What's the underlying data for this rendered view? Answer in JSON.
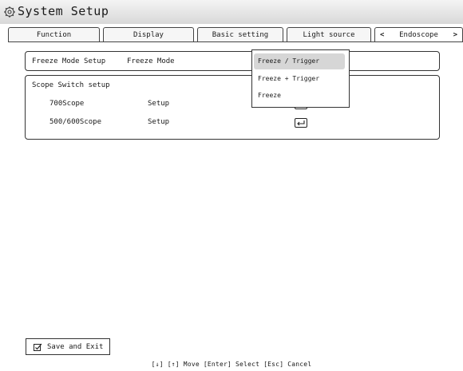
{
  "window": {
    "title": "System Setup",
    "title_icon": "gear-icon"
  },
  "tabs": [
    {
      "label": "Function"
    },
    {
      "label": "Display"
    },
    {
      "label": "Basic setting"
    },
    {
      "label": "Light source"
    },
    {
      "label": "Endoscope",
      "active": true
    }
  ],
  "tab_nav": {
    "prev": "<",
    "next": ">"
  },
  "freeze": {
    "section_label": "Freeze Mode Setup",
    "field_label": "Freeze Mode",
    "colon": ":",
    "dropdown_options": [
      {
        "label": "Freeze / Trigger",
        "selected": true
      },
      {
        "label": "Freeze + Trigger",
        "selected": false
      },
      {
        "label": "Freeze",
        "selected": false
      }
    ]
  },
  "scope": {
    "section_label": "Scope Switch setup",
    "rows": [
      {
        "name": "700Scope",
        "action": "Setup"
      },
      {
        "name": "500/600Scope",
        "action": "Setup"
      }
    ]
  },
  "save_button": {
    "label": "Save and Exit",
    "icon": "checkbox-icon"
  },
  "footer": {
    "keys_hint": "[↓] [↑] Move  [Enter] Select  [Esc] Cancel"
  },
  "colors": {
    "title_bar": "#dcdcdc",
    "selected_option": "#d6d6d6",
    "border": "#333333"
  }
}
